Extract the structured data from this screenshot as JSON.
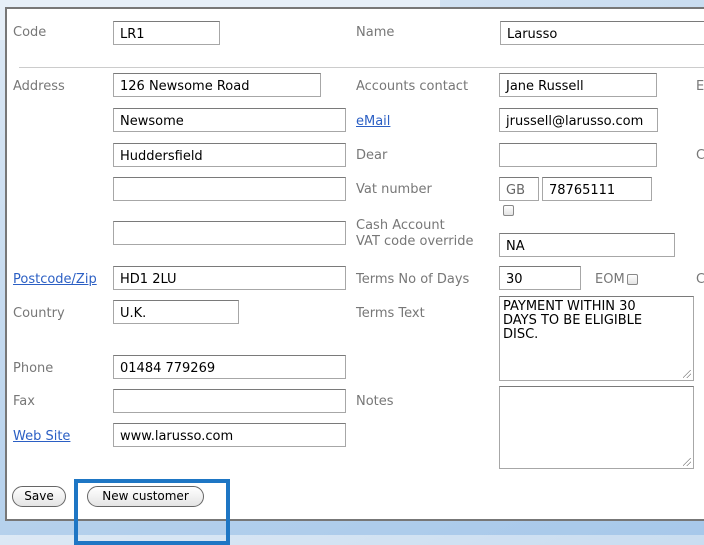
{
  "fields": {
    "code": {
      "label": "Code",
      "value": "LR1"
    },
    "name": {
      "label": "Name",
      "value": "Larusso"
    },
    "address": {
      "label": "Address",
      "lines": [
        "126 Newsome Road",
        "Newsome",
        "Huddersfield",
        "",
        ""
      ]
    },
    "accounts_contact": {
      "label": "Accounts contact",
      "value": "Jane Russell"
    },
    "email": {
      "label": "eMail",
      "value": "jrussell@larusso.com"
    },
    "dear": {
      "label": "Dear",
      "value": ""
    },
    "vat_number": {
      "label": "Vat number",
      "prefix": "GB",
      "value": "78765111"
    },
    "cash_account": {
      "label": "Cash Account"
    },
    "vat_override": {
      "label": "VAT code override",
      "value": "NA"
    },
    "postcode": {
      "label": "Postcode/Zip",
      "value": "HD1 2LU"
    },
    "terms_days": {
      "label": "Terms No of Days",
      "value": "30"
    },
    "eom": {
      "label": "EOM"
    },
    "country": {
      "label": "Country",
      "value": "U.K."
    },
    "terms_text": {
      "label": "Terms Text",
      "value": "PAYMENT WITHIN 30\nDAYS TO BE ELIGIBLE\nDISC."
    },
    "phone": {
      "label": "Phone",
      "value": "01484 779269"
    },
    "fax": {
      "label": "Fax",
      "value": ""
    },
    "notes": {
      "label": "Notes",
      "value": ""
    },
    "website": {
      "label": "Web Site",
      "value": "www.larusso.com"
    }
  },
  "clipped_labels": {
    "row_address": "E",
    "row_dear": "C",
    "row_terms": "C"
  },
  "buttons": {
    "save": "Save",
    "new_customer": "New customer"
  },
  "colors": {
    "highlight": "#1e76c4",
    "link": "#2b5fc4"
  }
}
